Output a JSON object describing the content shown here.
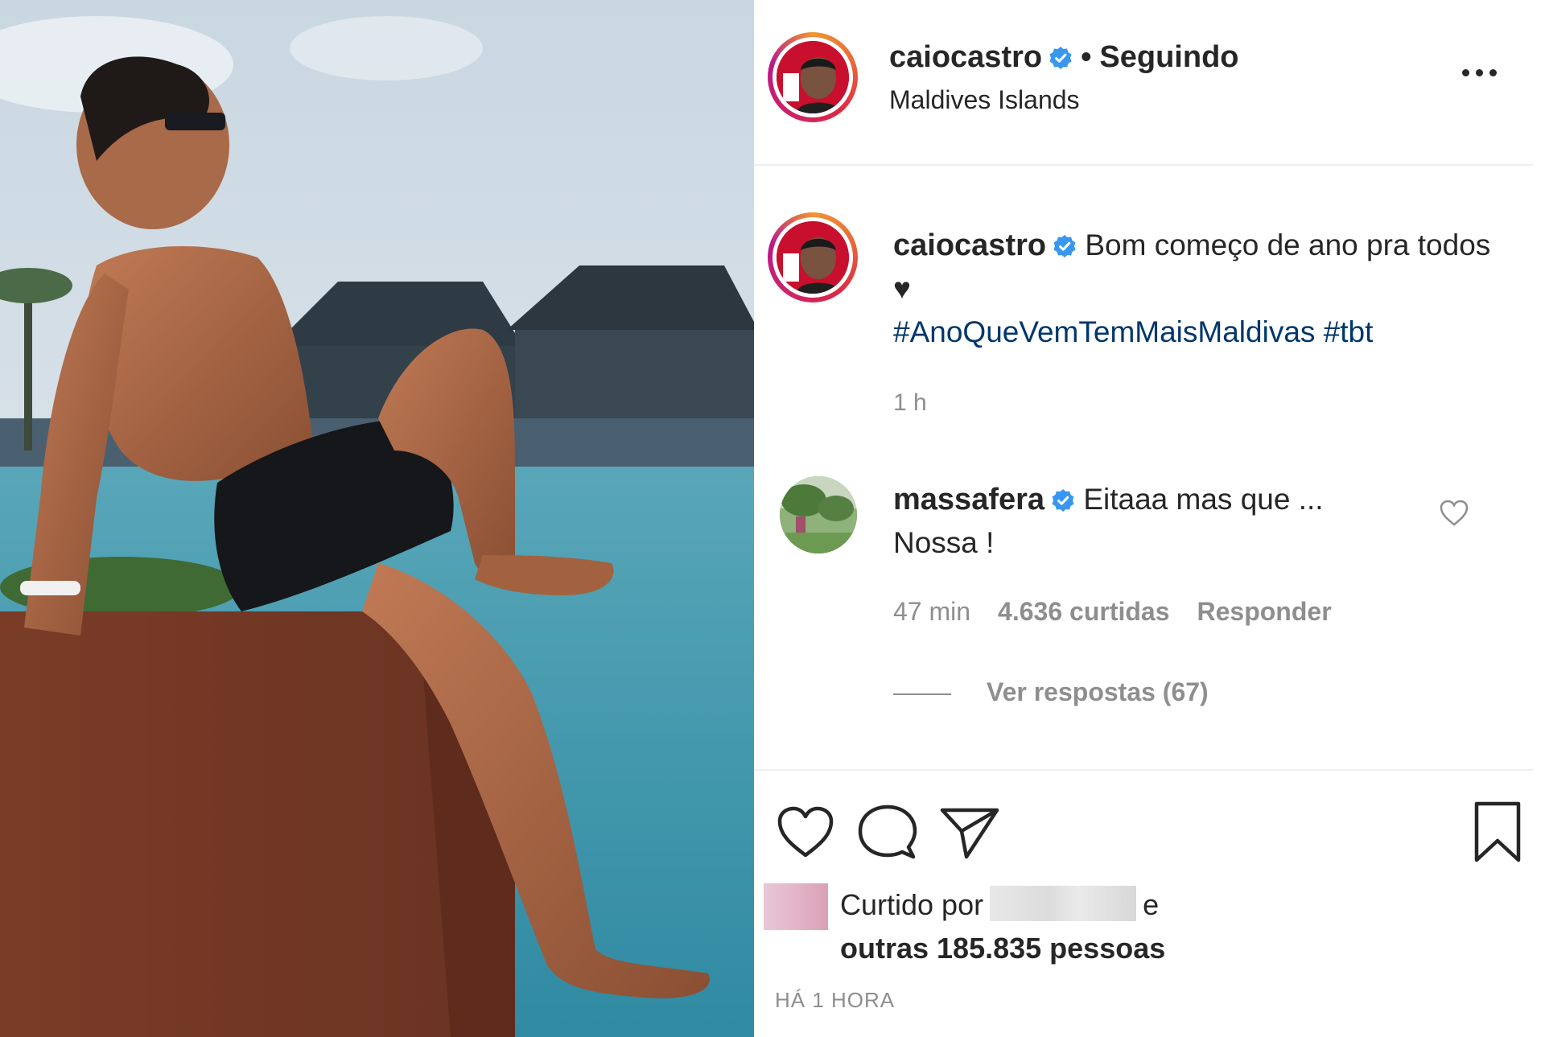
{
  "post": {
    "username": "caiocastro",
    "separator": "•",
    "follow_status": "Seguindo",
    "location": "Maldives Islands",
    "more_icon": "more-options-icon"
  },
  "caption": {
    "username": "caiocastro",
    "text": "Bom começo de ano pra todos ♥︎",
    "hashtags": "#AnoQueVemTemMaisMaldivas #tbt",
    "time": "1 h"
  },
  "comment": {
    "username": "massafera",
    "text": "Eitaaa mas que ... Nossa !",
    "time": "47 min",
    "likes": "4.636 curtidas",
    "reply_label": "Responder",
    "view_replies": "Ver respostas (67)"
  },
  "likes": {
    "prefix": "Curtido por",
    "connector": "e",
    "others": "outras 185.835 pessoas"
  },
  "posted_ago": "HÁ 1 HORA",
  "colors": {
    "text": "#262626",
    "muted": "#8e8e8e",
    "hashtag": "#00376b",
    "verified": "#3897f0"
  }
}
